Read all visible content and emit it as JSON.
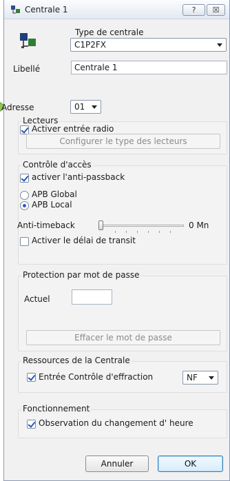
{
  "window": {
    "title": "Centrale 1",
    "help_label": "?",
    "close_label": "☒"
  },
  "header": {
    "type_label": "Type de centrale",
    "type_value": "C1P2FX"
  },
  "libelle": {
    "label": "Libellé",
    "value": "Centrale 1"
  },
  "adresse": {
    "label": "Adresse",
    "value": "01"
  },
  "lecteurs": {
    "title": "Lecteurs",
    "radio_checkbox_label": "Activer entrée radio",
    "radio_checked": true,
    "configure_button": "Configurer le type des lecteurs"
  },
  "controle": {
    "title": "Contrôle d'accès",
    "antipassback_label": "activer l'anti-passback",
    "antipassback_checked": true,
    "apb_global_label": "APB Global",
    "apb_local_label": "APB Local",
    "selected": "APB Local",
    "antitimeback_label": "Anti-timeback",
    "antitimeback_value": "0 Mn",
    "slider_fraction": 0,
    "transit_label": "Activer le délai de transit",
    "transit_checked": false
  },
  "protection": {
    "title": "Protection par mot de passe",
    "actuel_label": "Actuel",
    "actuel_value": "",
    "clear_button": "Effacer le mot de passe"
  },
  "ressources": {
    "title": "Ressources de la Centrale",
    "effraction_label": "Entrée Contrôle d'effraction",
    "effraction_checked": true,
    "effraction_value": "NF"
  },
  "fonctionnement": {
    "title": "Fonctionnement",
    "observation_label": "Observation  du changement d' heure",
    "observation_checked": true
  },
  "footer": {
    "cancel_label": "Annuler",
    "ok_label": "OK"
  },
  "colors": {
    "accent": "#2c5bc0",
    "ok_border": "#3c7fb1",
    "arrow": "#7ab648"
  }
}
